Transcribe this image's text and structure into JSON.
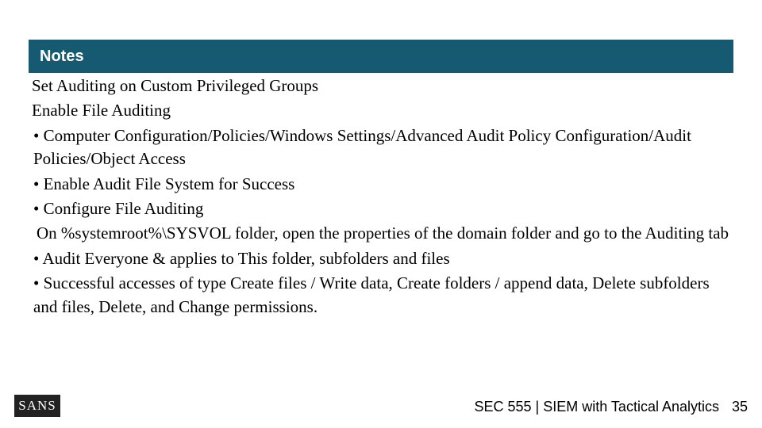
{
  "header": {
    "notes_label": "Notes"
  },
  "body": {
    "title1": "Set Auditing on Custom Privileged Groups",
    "title2": "Enable File Auditing",
    "b1": "• Computer Configuration/Policies/Windows Settings/Advanced Audit Policy Configuration/Audit Policies/Object Access",
    "b2": "• Enable Audit File System for Success",
    "b3": "• Configure File Auditing",
    "sub1": " On %systemroot%\\SYSVOL folder, open the properties of the domain folder and go to the Auditing tab",
    "b4": "• Audit Everyone & applies to This folder, subfolders and files",
    "b5": "• Successful accesses of type Create files / Write data, Create folders / append data, Delete subfolders and files, Delete, and Change permissions."
  },
  "footer": {
    "logo_text": "SANS",
    "course": "SEC 555 | SIEM with Tactical Analytics",
    "page": "35"
  }
}
